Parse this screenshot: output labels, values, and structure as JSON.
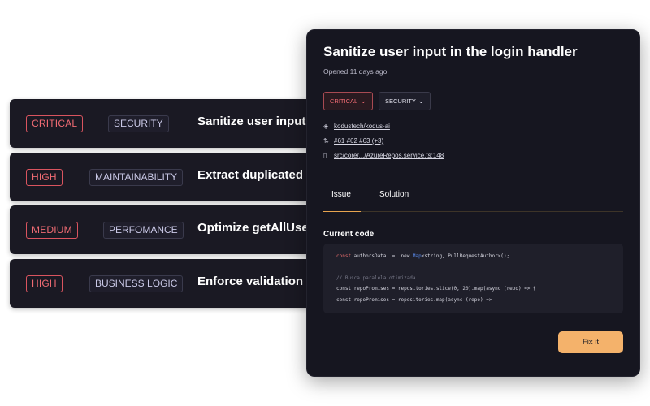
{
  "issues": [
    {
      "severity": "CRITICAL",
      "category": "SECURITY",
      "title": "Sanitize user input in the login handler"
    },
    {
      "severity": "HIGH",
      "category": "MAINTAINABILITY",
      "title": "Extract duplicated logic"
    },
    {
      "severity": "MEDIUM",
      "category": "PERFOMANCE",
      "title": "Optimize getAllUsers"
    },
    {
      "severity": "HIGH",
      "category": "BUSINESS LOGIC",
      "title": "Enforce validation on"
    }
  ],
  "panel": {
    "title": "Sanitize user input in the login handler",
    "opened": "Opened 11 days ago",
    "severity_select": "CRITICAL",
    "category_select": "SECURITY",
    "repo": "kodustech/kodus-ai",
    "pull_requests": "#61 #62 #63 (+3)",
    "file_path": "src/core/.../AzureRepos.service.ts:148",
    "tabs": [
      "Issue",
      "Solution"
    ],
    "active_tab": "Issue",
    "code_label": "Current code",
    "code": {
      "l1_kw": "const",
      "l1_a": " authorsData  =  new ",
      "l1_ty": "Map",
      "l1_b": "<string, PullRequestAuthor>();",
      "l2": "// Busca paralela otimizada",
      "l3": "const repoPromises = repositories.slice(0, 20).map(async (repo) => {",
      "l4": "const repoPromises = repositories.map(async (repo) =>"
    },
    "fix_button": "Fix it"
  },
  "colors": {
    "severity": "#f06b73",
    "accent": "#f4b26b",
    "panel_bg": "#161620",
    "card_bg": "#1a1923"
  },
  "icons": [
    "branch-icon",
    "pull-request-icon",
    "file-icon",
    "chevron-down-icon"
  ]
}
